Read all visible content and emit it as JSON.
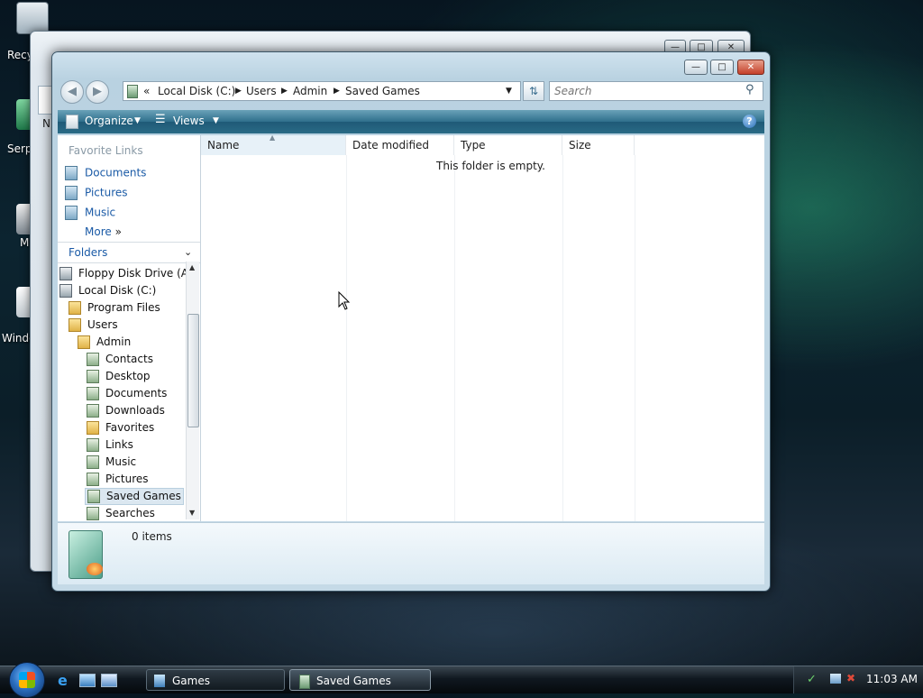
{
  "desktop": {
    "icons": [
      {
        "label": "Recy",
        "icon": "recycle-bin-icon"
      },
      {
        "label": "Serpe",
        "icon": "serpentine-game-icon"
      },
      {
        "label": "M",
        "icon": "media-icon"
      },
      {
        "label": "Windo",
        "icon": "windows-card-game-icon"
      }
    ]
  },
  "back_window": {
    "partial_text": "N"
  },
  "window": {
    "address": {
      "segments": [
        "«",
        "Local Disk (C:)",
        "Users",
        "Admin",
        "Saved Games"
      ]
    },
    "search": {
      "placeholder": "Search"
    },
    "toolbar": {
      "organize": "Organize",
      "views": "Views"
    },
    "nav": {
      "favorite_links_heading": "Favorite Links",
      "favorite_links": [
        "Documents",
        "Pictures",
        "Music"
      ],
      "more": "More",
      "folders_heading": "Folders",
      "tree": [
        {
          "label": "Floppy Disk Drive (A:)",
          "icon": "floppy-drive-icon"
        },
        {
          "label": "Local Disk (C:)",
          "icon": "hard-drive-icon"
        },
        {
          "label": "Program Files",
          "icon": "folder-icon"
        },
        {
          "label": "Users",
          "icon": "folder-icon"
        },
        {
          "label": "Admin",
          "icon": "folder-icon"
        },
        {
          "label": "Contacts",
          "icon": "contacts-folder-icon"
        },
        {
          "label": "Desktop",
          "icon": "desktop-folder-icon"
        },
        {
          "label": "Documents",
          "icon": "documents-folder-icon"
        },
        {
          "label": "Downloads",
          "icon": "downloads-folder-icon"
        },
        {
          "label": "Favorites",
          "icon": "favorites-folder-icon"
        },
        {
          "label": "Links",
          "icon": "links-folder-icon"
        },
        {
          "label": "Music",
          "icon": "music-folder-icon"
        },
        {
          "label": "Pictures",
          "icon": "pictures-folder-icon"
        },
        {
          "label": "Saved Games",
          "icon": "saved-games-folder-icon",
          "selected": true
        },
        {
          "label": "Searches",
          "icon": "searches-folder-icon"
        }
      ]
    },
    "columns": [
      "Name",
      "Date modified",
      "Type",
      "Size"
    ],
    "empty_message": "This folder is empty.",
    "details": {
      "item_count": "0 items"
    }
  },
  "taskbar": {
    "buttons": [
      "Games",
      "Saved Games"
    ],
    "clock": "11:03 AM"
  },
  "colors": {
    "toolbar": "#2a6b86",
    "link": "#1a5aa6",
    "selection": "#dbe7f0"
  }
}
